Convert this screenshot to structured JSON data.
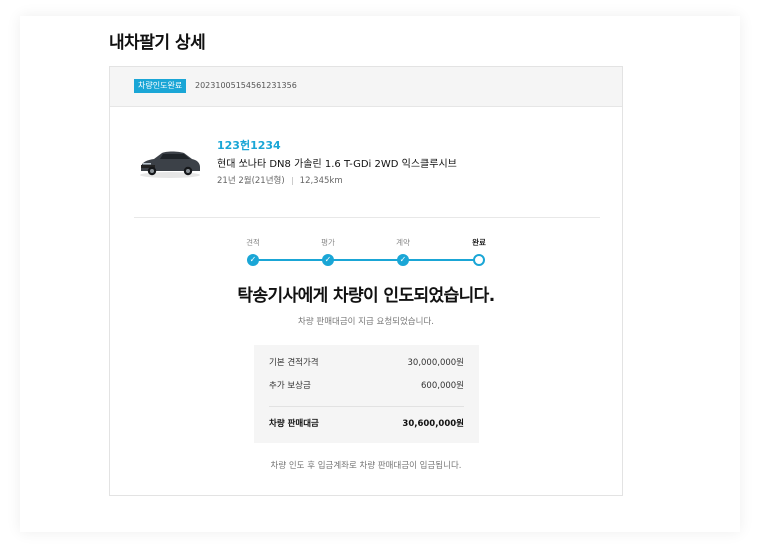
{
  "page": {
    "title": "내차팔기 상세"
  },
  "order": {
    "status_badge": "차량인도완료",
    "number": "20231005154561231356"
  },
  "vehicle": {
    "plate": "123헌1234",
    "model": "현대 쏘나타 DN8 가솔린 1.6 T-GDi 2WD 익스클루시브",
    "registration": "21년 2월(21년형)",
    "mileage": "12,345km"
  },
  "steps": {
    "items": [
      {
        "label": "견적",
        "state": "done"
      },
      {
        "label": "평가",
        "state": "done"
      },
      {
        "label": "계약",
        "state": "done"
      },
      {
        "label": "완료",
        "state": "current"
      }
    ],
    "accent_color": "#1aa6d6"
  },
  "message": {
    "headline": "탁송기사에게 차량이 인도되었습니다.",
    "subline": "차량 판매대금이 지급 요청되었습니다."
  },
  "prices": {
    "base_label": "기본 견적가격",
    "base_value": "30,000,000원",
    "extra_label": "추가 보상금",
    "extra_value": "600,000원",
    "total_label": "차량 판매대금",
    "total_value": "30,600,000원"
  },
  "footnote": "차량 인도 후 입금계좌로 차량 판매대금이 입금됩니다."
}
